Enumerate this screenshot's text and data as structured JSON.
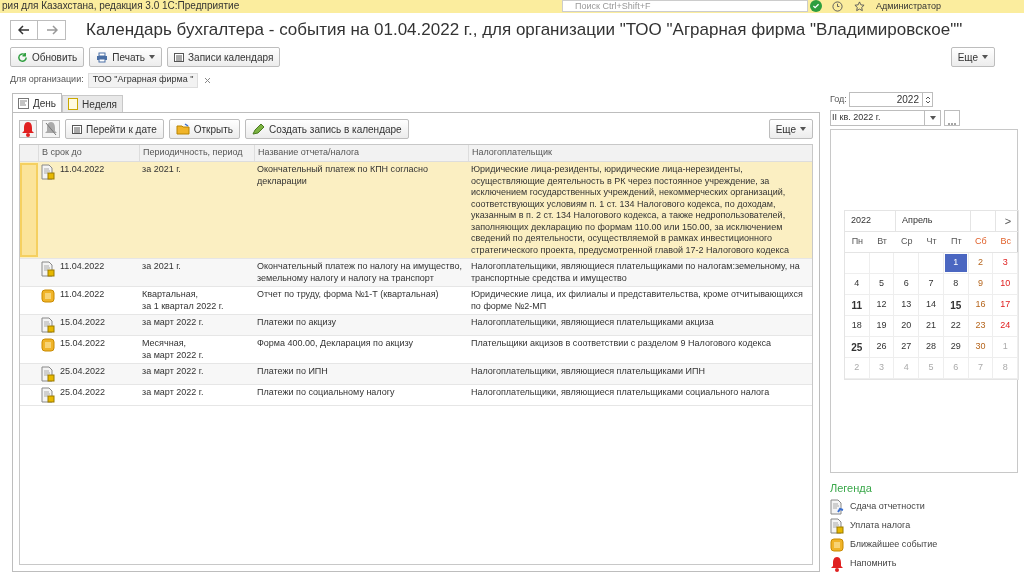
{
  "app_bar": {
    "title": "рия для Казахстана, редакция 3.0 1С:Предприятие",
    "search": {
      "placeholder": "Поиск Ctrl+Shift+F"
    },
    "user": "Администратор"
  },
  "window": {
    "title": "Календарь бухгалтера - события на 01.04.2022 г., для организации \"ТОО \"Аграрная фирма \"Владимировское\"\""
  },
  "toolbar": {
    "buttons": [
      "Обновить",
      "Печать",
      "Записи календаря"
    ],
    "more": "Еще"
  },
  "filter": {
    "label": "Для организации:",
    "value": "ТОО \"Аграрная фирма \""
  },
  "tabs": [
    {
      "label": "День",
      "selected": true
    },
    {
      "label": "Неделя",
      "selected": false
    }
  ],
  "day_toolbar": {
    "buttons": [
      "Перейти к дате",
      "Открыть",
      "Создать запись в календаре"
    ],
    "more": "Еще"
  },
  "table": {
    "columns": [
      "В срок до",
      "Периодичность, период",
      "Название отчета/налога",
      "Налогоплательщик"
    ],
    "rows": [
      {
        "kind": "tax",
        "selected": true,
        "cells": [
          "11.04.2022",
          "за 2021 г.",
          "Окончательный платеж по КПН согласно декларации",
          "Юридические лица-резиденты, юридические лица-нерезиденты, осуществляющие деятельность в РК через постоянное учреждение, за исключением государственных учреждений, некоммерческих организаций, соответствующих условиям п. 1 ст. 134 Налогового кодекса, по доходам, указанным в п. 2 ст. 134 Налогового кодекса, а также недропользователей, заполняющих декларацию по формам 110.00 или 150.00, за исключением сведений по деятельности, осуществляемой в рамках инвестиционного стратегического проекта, предусмотренной главой 17-2 Налогового кодекса"
        ]
      },
      {
        "kind": "tax",
        "selected": false,
        "cells": [
          "11.04.2022",
          "за 2021 г.",
          "Окончательный платеж по налогу на имущество, земельному налогу и налогу на транспорт",
          "Налогоплательщики, являющиеся плательщиками по налогам:земельному, на транспортные средства и имущество"
        ]
      },
      {
        "kind": "nearest",
        "selected": false,
        "cells": [
          "11.04.2022",
          "Квартальная,\nза 1 квартал 2022 г.",
          "Отчет по труду, форма №1-Т (квартальная)",
          "Юридические лица, их филиалы и представительства, кроме отчитывающихся по форме №2-МП"
        ]
      },
      {
        "kind": "tax",
        "selected": false,
        "cells": [
          "15.04.2022",
          "за март 2022 г.",
          "Платежи по акцизу",
          "Налогоплательщики, являющиеся плательщиками акциза"
        ]
      },
      {
        "kind": "nearest",
        "selected": false,
        "cells": [
          "15.04.2022",
          "Месячная,\nза март 2022 г.",
          "Форма 400.00, Декларация по акцизу",
          "Плательщики акцизов в соответствии с разделом 9 Налогового кодекса"
        ]
      },
      {
        "kind": "tax",
        "selected": false,
        "cells": [
          "25.04.2022",
          "за март 2022 г.",
          "Платежи по ИПН",
          "Налогоплательщики, являющиеся плательщиками ИПН"
        ]
      },
      {
        "kind": "tax",
        "selected": false,
        "cells": [
          "25.04.2022",
          "за март 2022 г.",
          "Платежи по социальному налогу",
          "Налогоплательщики, являющиеся плательщиками социального налога"
        ]
      }
    ]
  },
  "year": {
    "label": "Год:",
    "value": "2022"
  },
  "period": {
    "value": "II кв. 2022 г."
  },
  "calendar": {
    "year": "2022",
    "month": "Апрель",
    "next": ">",
    "weekdays": [
      "Пн",
      "Вт",
      "Ср",
      "Чт",
      "Пт",
      "Сб",
      "Вс"
    ],
    "weeks": [
      [
        {
          "kind": "blank"
        },
        {
          "kind": "blank"
        },
        {
          "kind": "blank"
        },
        {
          "kind": "blank"
        },
        {
          "day": "1",
          "kind": "current",
          "bold": false,
          "selected": true
        },
        {
          "day": "2",
          "kind": "current",
          "bold": false,
          "selected": false
        },
        {
          "day": "3",
          "kind": "current",
          "bold": false,
          "selected": false
        }
      ],
      [
        {
          "day": "4",
          "kind": "current",
          "bold": false,
          "selected": false
        },
        {
          "day": "5",
          "kind": "current",
          "bold": false,
          "selected": false
        },
        {
          "day": "6",
          "kind": "current",
          "bold": false,
          "selected": false
        },
        {
          "day": "7",
          "kind": "current",
          "bold": false,
          "selected": false
        },
        {
          "day": "8",
          "kind": "current",
          "bold": false,
          "selected": false
        },
        {
          "day": "9",
          "kind": "current",
          "bold": false,
          "selected": false
        },
        {
          "day": "10",
          "kind": "current",
          "bold": false,
          "selected": false
        }
      ],
      [
        {
          "day": "11",
          "kind": "current",
          "bold": true,
          "selected": false
        },
        {
          "day": "12",
          "kind": "current",
          "bold": false,
          "selected": false
        },
        {
          "day": "13",
          "kind": "current",
          "bold": false,
          "selected": false
        },
        {
          "day": "14",
          "kind": "current",
          "bold": false,
          "selected": false
        },
        {
          "day": "15",
          "kind": "current",
          "bold": true,
          "selected": false
        },
        {
          "day": "16",
          "kind": "current",
          "bold": false,
          "selected": false
        },
        {
          "day": "17",
          "kind": "current",
          "bold": false,
          "selected": false
        }
      ],
      [
        {
          "day": "18",
          "kind": "current",
          "bold": false,
          "selected": false
        },
        {
          "day": "19",
          "kind": "current",
          "bold": false,
          "selected": false
        },
        {
          "day": "20",
          "kind": "current",
          "bold": false,
          "selected": false
        },
        {
          "day": "21",
          "kind": "current",
          "bold": false,
          "selected": false
        },
        {
          "day": "22",
          "kind": "current",
          "bold": false,
          "selected": false
        },
        {
          "day": "23",
          "kind": "current",
          "bold": false,
          "selected": false
        },
        {
          "day": "24",
          "kind": "current",
          "bold": false,
          "selected": false
        }
      ],
      [
        {
          "day": "25",
          "kind": "current",
          "bold": true,
          "selected": false
        },
        {
          "day": "26",
          "kind": "current",
          "bold": false,
          "selected": false
        },
        {
          "day": "27",
          "kind": "current",
          "bold": false,
          "selected": false
        },
        {
          "day": "28",
          "kind": "current",
          "bold": false,
          "selected": false
        },
        {
          "day": "29",
          "kind": "current",
          "bold": false,
          "selected": false
        },
        {
          "day": "30",
          "kind": "current",
          "bold": false,
          "selected": false
        },
        {
          "day": "1",
          "kind": "other",
          "bold": false,
          "selected": false
        }
      ],
      [
        {
          "day": "2",
          "kind": "other",
          "bold": false,
          "selected": false
        },
        {
          "day": "3",
          "kind": "other",
          "bold": false,
          "selected": false
        },
        {
          "day": "4",
          "kind": "other",
          "bold": false,
          "selected": false
        },
        {
          "day": "5",
          "kind": "other",
          "bold": false,
          "selected": false
        },
        {
          "day": "6",
          "kind": "other",
          "bold": false,
          "selected": false
        },
        {
          "day": "7",
          "kind": "other",
          "bold": false,
          "selected": false
        },
        {
          "day": "8",
          "kind": "other",
          "bold": false,
          "selected": false
        }
      ]
    ]
  },
  "legend": {
    "title": "Легенда",
    "items": [
      {
        "kind": "report",
        "label": "Сдача отчетности"
      },
      {
        "kind": "tax",
        "label": "Уплата налога"
      },
      {
        "kind": "nearest",
        "label": "Ближайшее событие"
      },
      {
        "kind": "remind",
        "label": "Напомнить"
      }
    ]
  }
}
